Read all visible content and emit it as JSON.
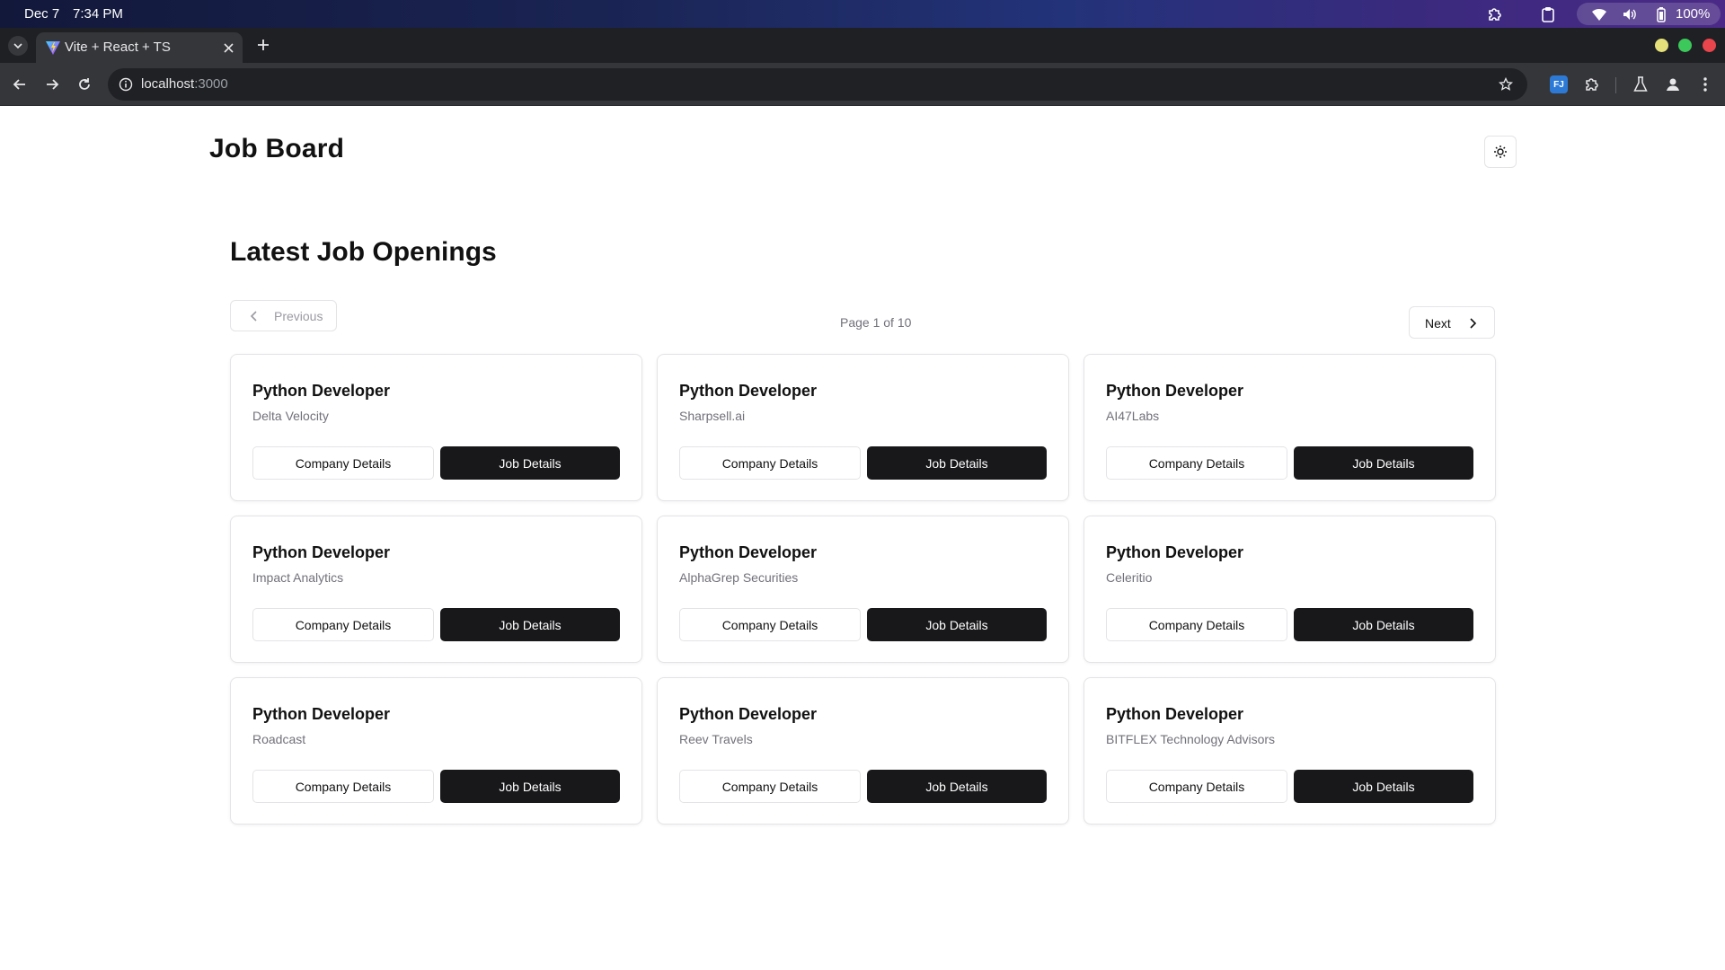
{
  "os": {
    "date": "Dec 7",
    "time": "7:34 PM",
    "battery": "100%",
    "icons": [
      "extension-puzzle-icon",
      "clipboard-icon",
      "wifi-icon",
      "volume-icon",
      "battery-icon"
    ]
  },
  "browser": {
    "tab_title": "Vite + React + TS",
    "url_host": "localhost",
    "url_port": ":3000",
    "extension_badge": "FJ",
    "window_controls": {
      "minimize": "#e5e07a",
      "maximize": "#3cc85a",
      "close": "#e8454c"
    }
  },
  "header": {
    "title": "Job Board",
    "theme_toggle_icon": "sun-icon"
  },
  "main": {
    "heading": "Latest Job Openings",
    "pagination": {
      "previous_label": "Previous",
      "next_label": "Next",
      "page_indicator": "Page 1 of 10"
    },
    "jobs": [
      {
        "title": "Python Developer",
        "company": "Delta Velocity",
        "company_btn": "Company Details",
        "job_btn": "Job Details"
      },
      {
        "title": "Python Developer",
        "company": "Sharpsell.ai",
        "company_btn": "Company Details",
        "job_btn": "Job Details"
      },
      {
        "title": "Python Developer",
        "company": "AI47Labs",
        "company_btn": "Company Details",
        "job_btn": "Job Details"
      },
      {
        "title": "Python Developer",
        "company": "Impact Analytics",
        "company_btn": "Company Details",
        "job_btn": "Job Details"
      },
      {
        "title": "Python Developer",
        "company": "AlphaGrep Securities",
        "company_btn": "Company Details",
        "job_btn": "Job Details"
      },
      {
        "title": "Python Developer",
        "company": "Celeritio",
        "company_btn": "Company Details",
        "job_btn": "Job Details"
      },
      {
        "title": "Python Developer",
        "company": "Roadcast",
        "company_btn": "Company Details",
        "job_btn": "Job Details"
      },
      {
        "title": "Python Developer",
        "company": "Reev Travels",
        "company_btn": "Company Details",
        "job_btn": "Job Details"
      },
      {
        "title": "Python Developer",
        "company": "BITFLEX Technology Advisors",
        "company_btn": "Company Details",
        "job_btn": "Job Details"
      }
    ]
  },
  "colors": {
    "primary_button": "#18181b",
    "border": "#e4e4e7",
    "muted_text": "#71717a"
  }
}
